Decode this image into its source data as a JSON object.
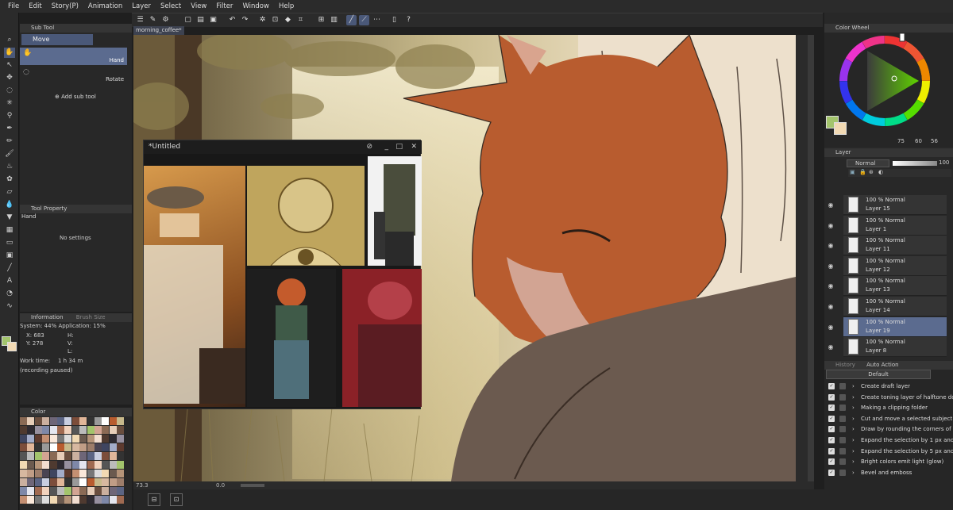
{
  "menu": [
    "File",
    "Edit",
    "Story(P)",
    "Animation",
    "Layer",
    "Select",
    "View",
    "Filter",
    "Window",
    "Help"
  ],
  "subtool": {
    "tab": "Sub Tool",
    "group": "Move",
    "items": [
      "Hand",
      "Rotate"
    ],
    "add_label": "Add sub tool"
  },
  "tool_property": {
    "tab": "Tool Property",
    "tool_name": "Hand",
    "empty_text": "No settings"
  },
  "information": {
    "tab": "Information",
    "tab2": "Brush Size",
    "system": "System: 44%  Application: 15%",
    "x": "X: 683",
    "y": "Y: 278",
    "h": "H:",
    "v": "V:",
    "l": "L:",
    "work_time_label": "Work time:",
    "work_time_value": "1 h 34 m",
    "recording": "(recording paused)"
  },
  "color_sets": {
    "tab": "Color"
  },
  "document": {
    "tab_name": "morning_coffee*"
  },
  "status": {
    "zoom": "73.3",
    "angle": "0.0"
  },
  "reference_window": {
    "title": "*Untitled"
  },
  "color_wheel": {
    "tab": "Color Wheel",
    "h": "75",
    "s": "60",
    "v": "56",
    "main_color": "#a3c46c",
    "sub_color": "#f1d9b3"
  },
  "layer_panel": {
    "tab": "Layer",
    "blend_mode": "Normal",
    "opacity": "100",
    "layers": [
      {
        "mode": "100 % Normal",
        "name": "Layer 15",
        "selected": false
      },
      {
        "mode": "100 % Normal",
        "name": "Layer 1",
        "selected": false
      },
      {
        "mode": "100 % Normal",
        "name": "Layer 11",
        "selected": false
      },
      {
        "mode": "100 % Normal",
        "name": "Layer 12",
        "selected": false
      },
      {
        "mode": "100 % Normal",
        "name": "Layer 13",
        "selected": false
      },
      {
        "mode": "100 % Normal",
        "name": "Layer 14",
        "selected": false
      },
      {
        "mode": "100 % Normal",
        "name": "Layer 19",
        "selected": true
      },
      {
        "mode": "100 % Normal",
        "name": "Layer 8",
        "selected": false
      }
    ]
  },
  "auto_action": {
    "tab1": "History",
    "tab2": "Auto Action",
    "set": "Default",
    "items": [
      "Create draft layer",
      "Create toning layer of halftone dots",
      "Making a clipping folder",
      "Cut and move a selected subject to a",
      "Draw by rounding the corners of selec",
      "Expand the selection by 1 px and fill",
      "Expand the selection by 5 px and fill",
      "Bright colors emit light (glow)",
      "Bevel and emboss"
    ]
  }
}
